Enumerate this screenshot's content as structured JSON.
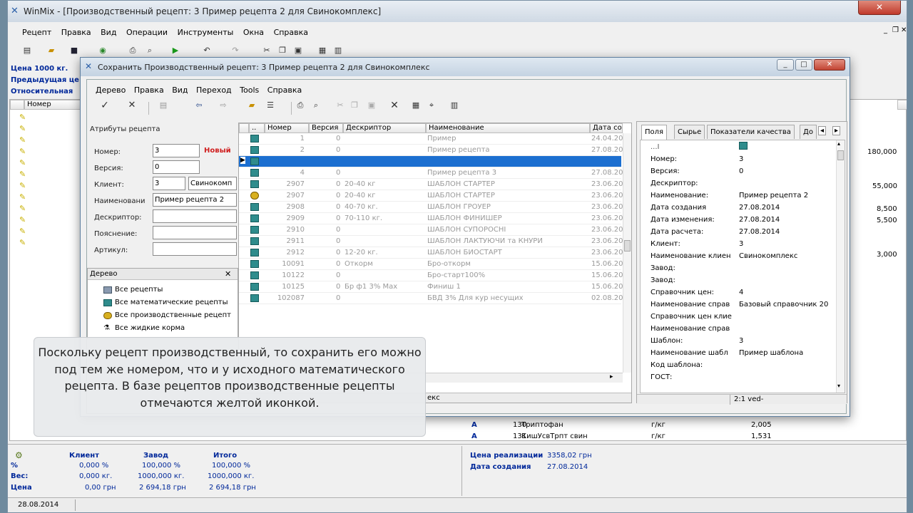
{
  "app": {
    "title": "WinMix - [Производственный рецепт: 3  Пример рецепта 2 для Свинокомплекс]",
    "menu": [
      "Рецепт",
      "Правка",
      "Вид",
      "Операции",
      "Инструменты",
      "Окна",
      "Справка"
    ]
  },
  "background": {
    "left_labels": [
      "Цена 1000 кг.",
      "Предыдущая це",
      "Относительная"
    ],
    "grid_header": [
      "",
      "Номер"
    ],
    "right_values": [
      "180,000",
      "55,000",
      "8,500",
      "5,500",
      "3,000"
    ],
    "rows_below": [
      {
        "num": "130",
        "name": "Триптофан",
        "unit": "г/кг",
        "value": "2,005"
      },
      {
        "num": "131",
        "name": "КишУсвТрпт свин",
        "unit": "г/кг",
        "value": "1,531"
      }
    ]
  },
  "dialog": {
    "title": "Сохранить Производственный рецепт: 3  Пример рецепта 2 для Свинокомплекс",
    "menu": [
      "Дерево",
      "Правка",
      "Вид",
      "Переход",
      "Tools",
      "Справка"
    ],
    "attributes": {
      "header": "Атрибуты рецепта",
      "number_label": "Номер:",
      "number_value": "3",
      "new_badge": "Новый",
      "version_label": "Версия:",
      "version_value": "0",
      "client_label": "Клиент:",
      "client_value": "3",
      "client_name": "Свинокомп",
      "name_label": "Наименовани",
      "name_value": "Пример рецепта 2",
      "descriptor_label": "Дескриптор:",
      "explanation_label": "Пояснение:",
      "article_label": "Артикул:"
    },
    "tree": {
      "header": "Дерево",
      "items": [
        "Все рецепты",
        "Все математические рецепты",
        "Все производственные рецепт",
        "Все жидкие корма"
      ]
    },
    "list": {
      "columns": [
        "",
        "Номер",
        "Версия",
        "Дескриптор",
        "Наименование",
        "Дата со"
      ],
      "rows": [
        {
          "num": "1",
          "ver": "0",
          "desc": "",
          "name": "Пример",
          "date": "24.04.20",
          "icon": "teal",
          "style": "gray"
        },
        {
          "num": "2",
          "ver": "0",
          "desc": "",
          "name": "Пример рецепта",
          "date": "27.08.20",
          "icon": "teal",
          "style": "gray"
        },
        {
          "num": "",
          "ver": "",
          "desc": "",
          "name": "",
          "date": "",
          "icon": "teal",
          "style": "selected"
        },
        {
          "num": "4",
          "ver": "0",
          "desc": "",
          "name": "Пример рецепта 3",
          "date": "27.08.20",
          "icon": "teal",
          "style": "gray"
        },
        {
          "num": "2907",
          "ver": "0",
          "desc": "20-40 кг",
          "name": "ШАБЛОН СТАРТЕР",
          "date": "23.06.20",
          "icon": "teal",
          "style": "gray"
        },
        {
          "num": "2907",
          "ver": "0",
          "desc": "20-40 кг",
          "name": "ШАБЛОН СТАРТЕР",
          "date": "23.06.20",
          "icon": "yellow",
          "style": "gray"
        },
        {
          "num": "2908",
          "ver": "0",
          "desc": "40-70 кг.",
          "name": "ШАБЛОН ГРОУЕР",
          "date": "23.06.20",
          "icon": "teal",
          "style": "gray"
        },
        {
          "num": "2909",
          "ver": "0",
          "desc": "70-110 кг.",
          "name": "ШАБЛОН ФИНИШЕР",
          "date": "23.06.20",
          "icon": "teal",
          "style": "gray"
        },
        {
          "num": "2910",
          "ver": "0",
          "desc": "",
          "name": "ШАБЛОН СУПОРОСНІ",
          "date": "23.06.20",
          "icon": "teal",
          "style": "gray"
        },
        {
          "num": "2911",
          "ver": "0",
          "desc": "",
          "name": "ШАБЛОН ЛАКТУЮЧИ та КНУРИ",
          "date": "23.06.20",
          "icon": "teal",
          "style": "gray"
        },
        {
          "num": "2912",
          "ver": "0",
          "desc": "12-20 кг.",
          "name": "ШАБЛОН БИОСТАРТ",
          "date": "23.06.20",
          "icon": "teal",
          "style": "gray"
        },
        {
          "num": "10091",
          "ver": "0",
          "desc": "Откорм",
          "name": "Бро-откорм",
          "date": "15.06.20",
          "icon": "teal",
          "style": "gray"
        },
        {
          "num": "10122",
          "ver": "0",
          "desc": "",
          "name": "Бро-старт100%",
          "date": "15.06.20",
          "icon": "teal",
          "style": "gray"
        },
        {
          "num": "10125",
          "ver": "0",
          "desc": "Бр ф1 3% Max",
          "name": "Финиш 1",
          "date": "15.06.20",
          "icon": "teal",
          "style": "gray"
        },
        {
          "num": "102087",
          "ver": "0",
          "desc": "",
          "name": "БВД 3% Для кур несущих",
          "date": "02.08.20",
          "icon": "teal",
          "style": "gray"
        }
      ],
      "status": "екс"
    },
    "props": {
      "tabs": [
        "Поля",
        "Сырье",
        "Показатели качества",
        "До"
      ],
      "top_mark": "...I",
      "items": [
        {
          "label": "Номер:",
          "value": "3"
        },
        {
          "label": "Версия:",
          "value": "0"
        },
        {
          "label": "Дескриптор:",
          "value": ""
        },
        {
          "label": "Наименование:",
          "value": "Пример рецепта 2"
        },
        {
          "label": "Дата создания",
          "value": "27.08.2014"
        },
        {
          "label": "Дата изменения:",
          "value": "27.08.2014"
        },
        {
          "label": "Дата расчета:",
          "value": "27.08.2014"
        },
        {
          "label": "Клиент:",
          "value": "3"
        },
        {
          "label": "Наименование клиен",
          "value": "Свинокомплекс"
        },
        {
          "label": "Завод:",
          "value": ""
        },
        {
          "label": "Завод:",
          "value": ""
        },
        {
          "label": "Справочник цен:",
          "value": "4"
        },
        {
          "label": "Наименование справ",
          "value": "Базовый справочник 20"
        },
        {
          "label": "Справочник цен клие",
          "value": ""
        },
        {
          "label": "Наименование справ",
          "value": ""
        },
        {
          "label": "Шаблон:",
          "value": "3"
        },
        {
          "label": "Наименование шабл",
          "value": "Пример шаблона"
        },
        {
          "label": "Код шаблона:",
          "value": ""
        },
        {
          "label": "ГОСТ:",
          "value": ""
        }
      ],
      "status": "2:1 ved-"
    }
  },
  "caption": "Поскольку рецепт производственный, то сохранить его можно под тем же номером, что и у исходного математического рецепта. В базе рецептов производственные рецепты отмечаются желтой иконкой.",
  "summary": {
    "headers": [
      "Клиент",
      "Завод",
      "Итого"
    ],
    "rows": [
      {
        "label": "%",
        "c": "0,000 %",
        "z": "100,000 %",
        "t": "100,000 %"
      },
      {
        "label": "Вес:",
        "c": "0,000 кг.",
        "z": "1000,000 кг.",
        "t": "1000,000 кг."
      },
      {
        "label": "Цена",
        "c": "0,00 грн",
        "z": "2 694,18 грн",
        "t": "2 694,18 грн"
      }
    ],
    "price_label": "Цена реализации",
    "price_value": "3358,02 грн",
    "date_label": "Дата создания",
    "date_value": "27.08.2014"
  },
  "statusbar": {
    "date": "28.08.2014"
  },
  "colors": {
    "selected": "#1c6fd0",
    "accent": "#00289a",
    "new": "#d02020"
  }
}
